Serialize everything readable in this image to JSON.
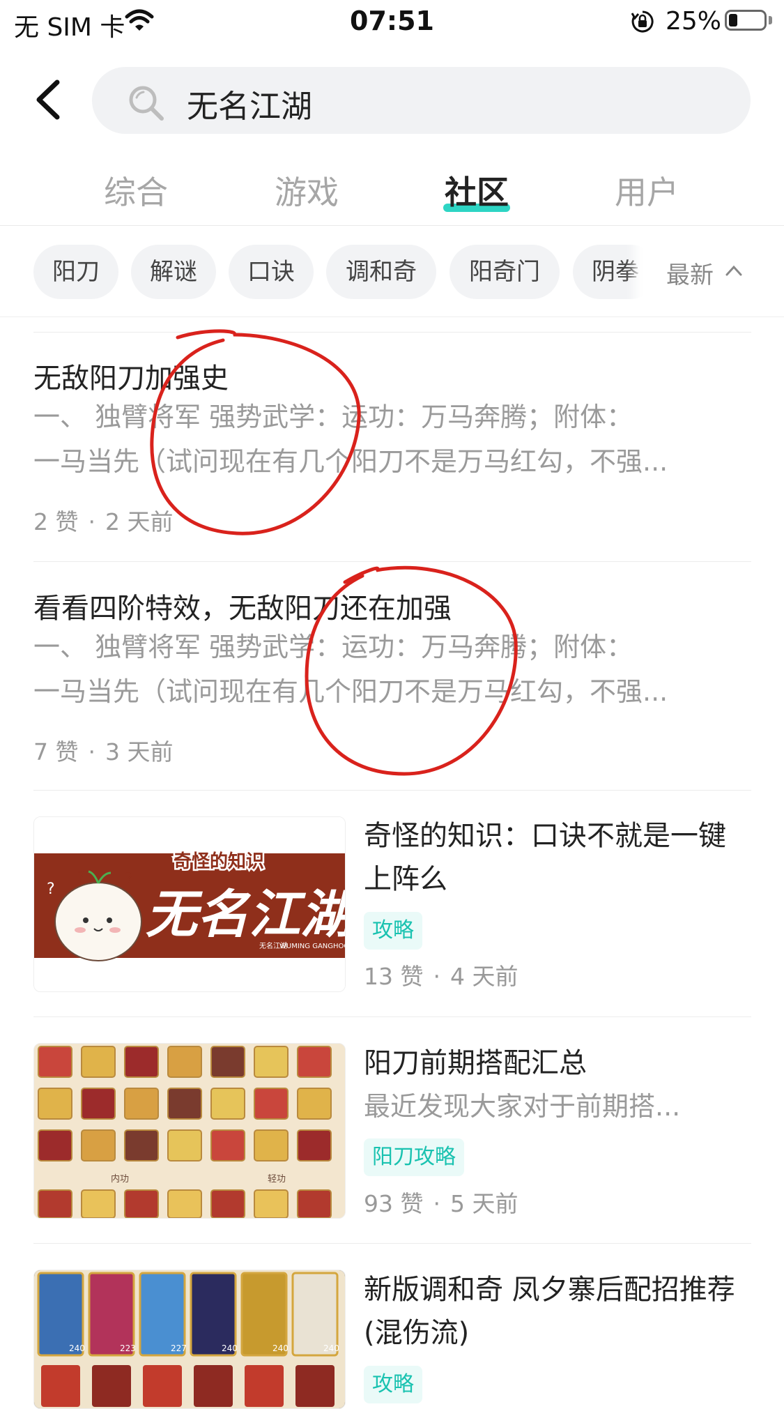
{
  "status": {
    "carrier": "无 SIM 卡",
    "time": "07:51",
    "battery": "25%"
  },
  "search": {
    "query": "无名江湖"
  },
  "tabs": [
    {
      "label": "综合"
    },
    {
      "label": "游戏"
    },
    {
      "label": "社区",
      "active": true
    },
    {
      "label": "用户"
    }
  ],
  "chips": [
    "阳刀",
    "解谜",
    "口诀",
    "调和奇",
    "阳奇门",
    "阴拳"
  ],
  "sort": {
    "label": "最新"
  },
  "posts": [
    {
      "title": "无敌阳刀加强史",
      "excerpt": [
        "一、 独臂将军    强势武学：运功：万马奔腾；附体：",
        "一马当先（试问现在有几个阳刀不是万马红勾，不强..."
      ],
      "likes": "2 赞",
      "time": "2 天前"
    },
    {
      "title": "看看四阶特效，无敌阳刀还在加强",
      "excerpt": [
        "一、 独臂将军    强势武学：运功：万马奔腾；附体：",
        "一马当先（试问现在有几个阳刀不是万马红勾，不强..."
      ],
      "likes": "7 赞",
      "time": "3 天前"
    },
    {
      "title": "奇怪的知识：口诀不就是一键上阵么",
      "tag": "攻略",
      "likes": "13 赞",
      "time": "4 天前",
      "thumb": {
        "banner_top": "奇怪的知识",
        "banner_main": "无名江湖",
        "banner_small_cn": "无名江湖",
        "banner_small_en": "WUMING GANGHOOD"
      }
    },
    {
      "title": "阳刀前期搭配汇总",
      "subtitle": "最近发现大家对于前期搭...",
      "tag": "阳刀攻略",
      "likes": "93 赞",
      "time": "5 天前",
      "thumb": {
        "section_left": "内功",
        "section_right": "轻功"
      }
    },
    {
      "title": "新版调和奇 凤夕寨后配招推荐 (混伤流)",
      "tag": "攻略",
      "thumb": {
        "card_values": [
          "240",
          "223",
          "227",
          "240",
          "240",
          "240"
        ]
      }
    }
  ],
  "colors": {
    "accent": "#2ed5c4",
    "tag_text": "#19c2b0",
    "annotation": "#d9221c",
    "banner": "#8f2f1b"
  }
}
